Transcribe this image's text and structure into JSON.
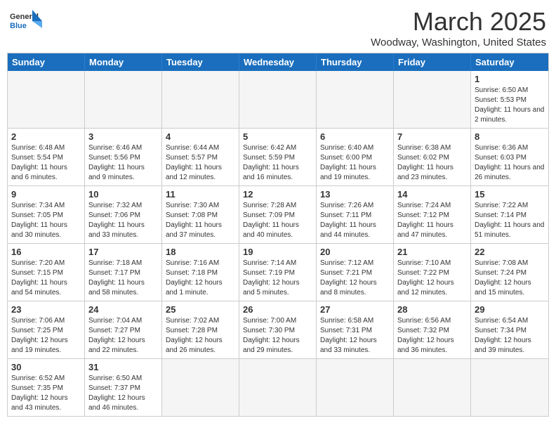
{
  "logo": {
    "general": "General",
    "blue": "Blue"
  },
  "title": "March 2025",
  "subtitle": "Woodway, Washington, United States",
  "days_of_week": [
    "Sunday",
    "Monday",
    "Tuesday",
    "Wednesday",
    "Thursday",
    "Friday",
    "Saturday"
  ],
  "weeks": [
    [
      {
        "num": "",
        "info": "",
        "empty": true
      },
      {
        "num": "",
        "info": "",
        "empty": true
      },
      {
        "num": "",
        "info": "",
        "empty": true
      },
      {
        "num": "",
        "info": "",
        "empty": true
      },
      {
        "num": "",
        "info": "",
        "empty": true
      },
      {
        "num": "",
        "info": "",
        "empty": true
      },
      {
        "num": "1",
        "info": "Sunrise: 6:50 AM\nSunset: 5:53 PM\nDaylight: 11 hours\nand 2 minutes.",
        "empty": false
      }
    ],
    [
      {
        "num": "2",
        "info": "Sunrise: 6:48 AM\nSunset: 5:54 PM\nDaylight: 11 hours\nand 6 minutes.",
        "empty": false
      },
      {
        "num": "3",
        "info": "Sunrise: 6:46 AM\nSunset: 5:56 PM\nDaylight: 11 hours\nand 9 minutes.",
        "empty": false
      },
      {
        "num": "4",
        "info": "Sunrise: 6:44 AM\nSunset: 5:57 PM\nDaylight: 11 hours\nand 12 minutes.",
        "empty": false
      },
      {
        "num": "5",
        "info": "Sunrise: 6:42 AM\nSunset: 5:59 PM\nDaylight: 11 hours\nand 16 minutes.",
        "empty": false
      },
      {
        "num": "6",
        "info": "Sunrise: 6:40 AM\nSunset: 6:00 PM\nDaylight: 11 hours\nand 19 minutes.",
        "empty": false
      },
      {
        "num": "7",
        "info": "Sunrise: 6:38 AM\nSunset: 6:02 PM\nDaylight: 11 hours\nand 23 minutes.",
        "empty": false
      },
      {
        "num": "8",
        "info": "Sunrise: 6:36 AM\nSunset: 6:03 PM\nDaylight: 11 hours\nand 26 minutes.",
        "empty": false
      }
    ],
    [
      {
        "num": "9",
        "info": "Sunrise: 7:34 AM\nSunset: 7:05 PM\nDaylight: 11 hours\nand 30 minutes.",
        "empty": false
      },
      {
        "num": "10",
        "info": "Sunrise: 7:32 AM\nSunset: 7:06 PM\nDaylight: 11 hours\nand 33 minutes.",
        "empty": false
      },
      {
        "num": "11",
        "info": "Sunrise: 7:30 AM\nSunset: 7:08 PM\nDaylight: 11 hours\nand 37 minutes.",
        "empty": false
      },
      {
        "num": "12",
        "info": "Sunrise: 7:28 AM\nSunset: 7:09 PM\nDaylight: 11 hours\nand 40 minutes.",
        "empty": false
      },
      {
        "num": "13",
        "info": "Sunrise: 7:26 AM\nSunset: 7:11 PM\nDaylight: 11 hours\nand 44 minutes.",
        "empty": false
      },
      {
        "num": "14",
        "info": "Sunrise: 7:24 AM\nSunset: 7:12 PM\nDaylight: 11 hours\nand 47 minutes.",
        "empty": false
      },
      {
        "num": "15",
        "info": "Sunrise: 7:22 AM\nSunset: 7:14 PM\nDaylight: 11 hours\nand 51 minutes.",
        "empty": false
      }
    ],
    [
      {
        "num": "16",
        "info": "Sunrise: 7:20 AM\nSunset: 7:15 PM\nDaylight: 11 hours\nand 54 minutes.",
        "empty": false
      },
      {
        "num": "17",
        "info": "Sunrise: 7:18 AM\nSunset: 7:17 PM\nDaylight: 11 hours\nand 58 minutes.",
        "empty": false
      },
      {
        "num": "18",
        "info": "Sunrise: 7:16 AM\nSunset: 7:18 PM\nDaylight: 12 hours\nand 1 minute.",
        "empty": false
      },
      {
        "num": "19",
        "info": "Sunrise: 7:14 AM\nSunset: 7:19 PM\nDaylight: 12 hours\nand 5 minutes.",
        "empty": false
      },
      {
        "num": "20",
        "info": "Sunrise: 7:12 AM\nSunset: 7:21 PM\nDaylight: 12 hours\nand 8 minutes.",
        "empty": false
      },
      {
        "num": "21",
        "info": "Sunrise: 7:10 AM\nSunset: 7:22 PM\nDaylight: 12 hours\nand 12 minutes.",
        "empty": false
      },
      {
        "num": "22",
        "info": "Sunrise: 7:08 AM\nSunset: 7:24 PM\nDaylight: 12 hours\nand 15 minutes.",
        "empty": false
      }
    ],
    [
      {
        "num": "23",
        "info": "Sunrise: 7:06 AM\nSunset: 7:25 PM\nDaylight: 12 hours\nand 19 minutes.",
        "empty": false
      },
      {
        "num": "24",
        "info": "Sunrise: 7:04 AM\nSunset: 7:27 PM\nDaylight: 12 hours\nand 22 minutes.",
        "empty": false
      },
      {
        "num": "25",
        "info": "Sunrise: 7:02 AM\nSunset: 7:28 PM\nDaylight: 12 hours\nand 26 minutes.",
        "empty": false
      },
      {
        "num": "26",
        "info": "Sunrise: 7:00 AM\nSunset: 7:30 PM\nDaylight: 12 hours\nand 29 minutes.",
        "empty": false
      },
      {
        "num": "27",
        "info": "Sunrise: 6:58 AM\nSunset: 7:31 PM\nDaylight: 12 hours\nand 33 minutes.",
        "empty": false
      },
      {
        "num": "28",
        "info": "Sunrise: 6:56 AM\nSunset: 7:32 PM\nDaylight: 12 hours\nand 36 minutes.",
        "empty": false
      },
      {
        "num": "29",
        "info": "Sunrise: 6:54 AM\nSunset: 7:34 PM\nDaylight: 12 hours\nand 39 minutes.",
        "empty": false
      }
    ],
    [
      {
        "num": "30",
        "info": "Sunrise: 6:52 AM\nSunset: 7:35 PM\nDaylight: 12 hours\nand 43 minutes.",
        "empty": false
      },
      {
        "num": "31",
        "info": "Sunrise: 6:50 AM\nSunset: 7:37 PM\nDaylight: 12 hours\nand 46 minutes.",
        "empty": false
      },
      {
        "num": "",
        "info": "",
        "empty": true
      },
      {
        "num": "",
        "info": "",
        "empty": true
      },
      {
        "num": "",
        "info": "",
        "empty": true
      },
      {
        "num": "",
        "info": "",
        "empty": true
      },
      {
        "num": "",
        "info": "",
        "empty": true
      }
    ]
  ]
}
